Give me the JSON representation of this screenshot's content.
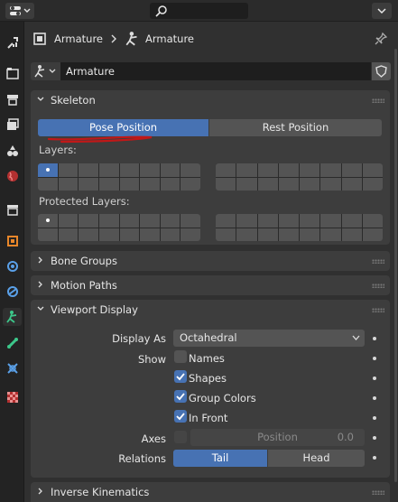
{
  "breadcrumb": {
    "object": "Armature",
    "data": "Armature"
  },
  "datablock": {
    "name": "Armature"
  },
  "skeleton": {
    "title": "Skeleton",
    "pose_label": "Pose Position",
    "rest_label": "Rest Position",
    "layers_label": "Layers:",
    "protected_label": "Protected Layers:"
  },
  "panels": {
    "bone_groups": "Bone Groups",
    "motion_paths": "Motion Paths",
    "viewport_display": "Viewport Display",
    "inverse_kinematics": "Inverse Kinematics"
  },
  "viewport": {
    "display_as_label": "Display As",
    "display_as_value": "Octahedral",
    "show_label": "Show",
    "names": "Names",
    "shapes": "Shapes",
    "group_colors": "Group Colors",
    "in_front": "In Front",
    "axes_label": "Axes",
    "position_label": "Position",
    "position_value": "0.0",
    "relations_label": "Relations",
    "tail": "Tail",
    "head": "Head"
  },
  "colors": {
    "accent": "#4772b3",
    "annotation": "#c01818"
  }
}
